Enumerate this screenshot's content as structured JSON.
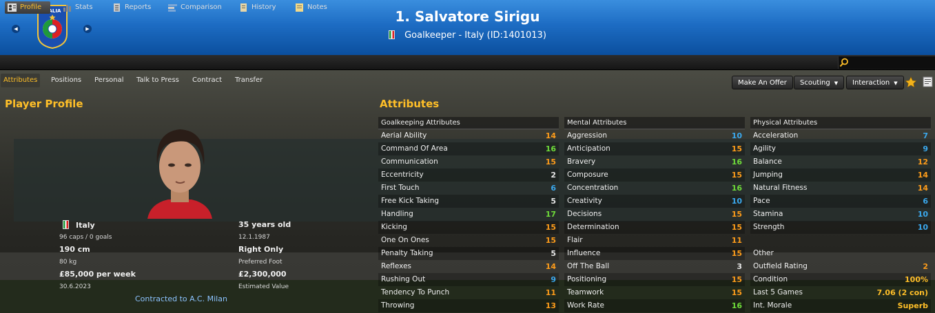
{
  "header": {
    "crest_text": "ITALIA",
    "name": "1. Salvatore Sirigu",
    "subtitle": "Goalkeeper - Italy (ID:1401013)"
  },
  "tabs": [
    "Profile",
    "Stats",
    "Reports",
    "Comparison",
    "History",
    "Notes"
  ],
  "subtabs": [
    "Attributes",
    "Positions",
    "Personal",
    "Talk to Press",
    "Contract",
    "Transfer"
  ],
  "actions": {
    "offer": "Make An Offer",
    "scouting": "Scouting",
    "interaction": "Interaction"
  },
  "profile": {
    "title": "Player Profile",
    "nation": "Italy",
    "caps": "96 caps / 0 goals",
    "height": "190 cm",
    "weight": "80 kg",
    "wage": "£85,000 per week",
    "wage_expiry": "30.6.2023",
    "age": "35 years old",
    "dob": "12.1.1987",
    "foot": "Right Only",
    "foot_label": "Preferred Foot",
    "value": "£2,300,000",
    "value_label": "Estimated Value",
    "contract": "Contracted to A.C. Milan"
  },
  "attributes": {
    "title": "Attributes",
    "goalkeeping": {
      "header": "Goalkeeping Attributes",
      "items": [
        {
          "name": "Aerial Ability",
          "value": "14",
          "color": "#ff9d1a"
        },
        {
          "name": "Command Of Area",
          "value": "16",
          "color": "#6fdc3a"
        },
        {
          "name": "Communication",
          "value": "15",
          "color": "#ff9d1a"
        },
        {
          "name": "Eccentricity",
          "value": "2",
          "color": "#e8e8e8"
        },
        {
          "name": "First Touch",
          "value": "6",
          "color": "#3ba9ee"
        },
        {
          "name": "Free Kick Taking",
          "value": "5",
          "color": "#e8e8e8"
        },
        {
          "name": "Handling",
          "value": "17",
          "color": "#6fdc3a"
        },
        {
          "name": "Kicking",
          "value": "15",
          "color": "#ff9d1a"
        },
        {
          "name": "One On Ones",
          "value": "15",
          "color": "#ff9d1a"
        },
        {
          "name": "Penalty Taking",
          "value": "5",
          "color": "#e8e8e8"
        },
        {
          "name": "Reflexes",
          "value": "14",
          "color": "#ff9d1a"
        },
        {
          "name": "Rushing Out",
          "value": "9",
          "color": "#3ba9ee"
        },
        {
          "name": "Tendency To Punch",
          "value": "11",
          "color": "#ff9d1a"
        },
        {
          "name": "Throwing",
          "value": "13",
          "color": "#ff9d1a"
        }
      ]
    },
    "mental": {
      "header": "Mental Attributes",
      "items": [
        {
          "name": "Aggression",
          "value": "10",
          "color": "#3ba9ee"
        },
        {
          "name": "Anticipation",
          "value": "15",
          "color": "#ff9d1a"
        },
        {
          "name": "Bravery",
          "value": "16",
          "color": "#6fdc3a"
        },
        {
          "name": "Composure",
          "value": "15",
          "color": "#ff9d1a"
        },
        {
          "name": "Concentration",
          "value": "16",
          "color": "#6fdc3a"
        },
        {
          "name": "Creativity",
          "value": "10",
          "color": "#3ba9ee"
        },
        {
          "name": "Decisions",
          "value": "15",
          "color": "#ff9d1a"
        },
        {
          "name": "Determination",
          "value": "15",
          "color": "#ff9d1a"
        },
        {
          "name": "Flair",
          "value": "11",
          "color": "#ff9d1a"
        },
        {
          "name": "Influence",
          "value": "15",
          "color": "#ff9d1a"
        },
        {
          "name": "Off The Ball",
          "value": "3",
          "color": "#e8e8e8"
        },
        {
          "name": "Positioning",
          "value": "15",
          "color": "#ff9d1a"
        },
        {
          "name": "Teamwork",
          "value": "15",
          "color": "#ff9d1a"
        },
        {
          "name": "Work Rate",
          "value": "16",
          "color": "#6fdc3a"
        }
      ]
    },
    "physical": {
      "header": "Physical Attributes",
      "items": [
        {
          "name": "Acceleration",
          "value": "7",
          "color": "#3ba9ee"
        },
        {
          "name": "Agility",
          "value": "9",
          "color": "#3ba9ee"
        },
        {
          "name": "Balance",
          "value": "12",
          "color": "#ff9d1a"
        },
        {
          "name": "Jumping",
          "value": "14",
          "color": "#ff9d1a"
        },
        {
          "name": "Natural Fitness",
          "value": "14",
          "color": "#ff9d1a"
        },
        {
          "name": "Pace",
          "value": "6",
          "color": "#3ba9ee"
        },
        {
          "name": "Stamina",
          "value": "10",
          "color": "#3ba9ee"
        },
        {
          "name": "Strength",
          "value": "10",
          "color": "#3ba9ee"
        }
      ]
    },
    "other": {
      "header": "Other",
      "items": [
        {
          "name": "Outfield Rating",
          "value": "2",
          "color": "#ff9d1a"
        },
        {
          "name": "Condition",
          "value": "100%",
          "color": "#ffbf28"
        },
        {
          "name": "Last 5 Games",
          "value": "7.06 (2 con)",
          "color": "#ffbf28"
        },
        {
          "name": "Int. Morale",
          "value": "Superb",
          "color": "#ffbf28"
        }
      ]
    }
  }
}
